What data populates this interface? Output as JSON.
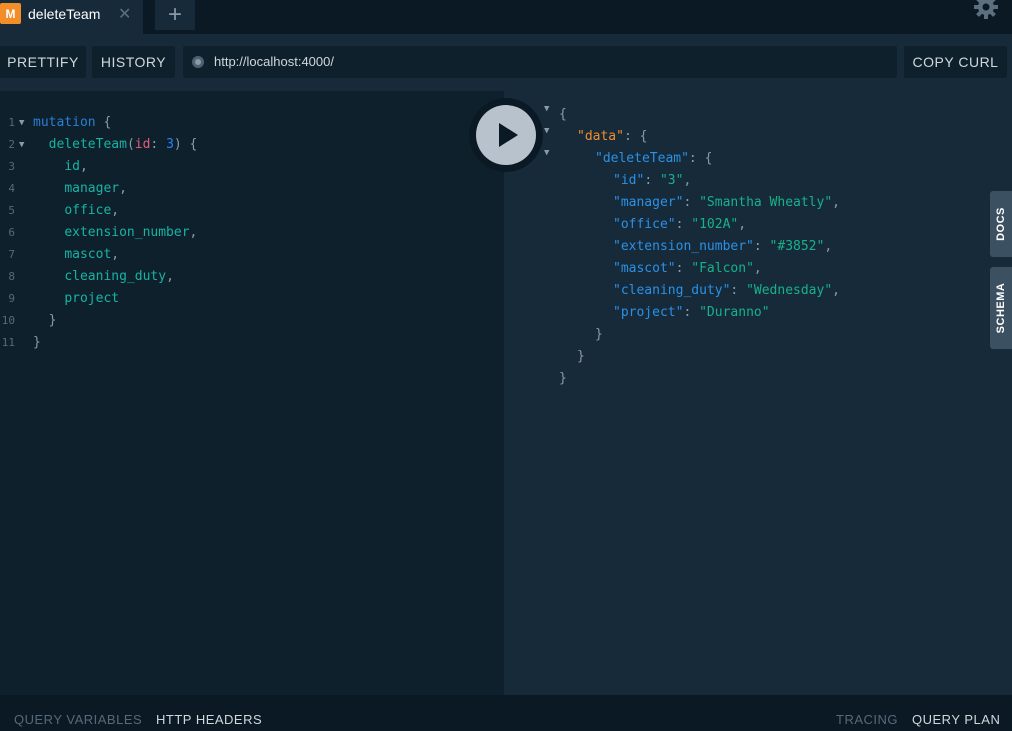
{
  "tab": {
    "badge": "M",
    "title": "deleteTeam",
    "close": "✕",
    "new_tab": "+"
  },
  "toolbar": {
    "prettify": "PRETTIFY",
    "history": "HISTORY",
    "url": "http://localhost:4000/",
    "copy_curl": "COPY CURL"
  },
  "query": {
    "lines": [
      {
        "num": "1"
      },
      {
        "num": "2"
      },
      {
        "num": "3"
      },
      {
        "num": "4"
      },
      {
        "num": "5"
      },
      {
        "num": "6"
      },
      {
        "num": "7"
      },
      {
        "num": "8"
      },
      {
        "num": "9"
      },
      {
        "num": "10"
      },
      {
        "num": "11"
      }
    ],
    "keyword": "mutation",
    "operation": "deleteTeam",
    "arg_name": "id",
    "arg_value": "3",
    "fields": [
      "id",
      "manager",
      "office",
      "extension_number",
      "mascot",
      "cleaning_duty",
      "project"
    ]
  },
  "result": {
    "data_key": "\"data\"",
    "op_key": "\"deleteTeam\"",
    "entries": [
      {
        "key": "\"id\"",
        "value": "\"3\""
      },
      {
        "key": "\"manager\"",
        "value": "\"Smantha Wheatly\""
      },
      {
        "key": "\"office\"",
        "value": "\"102A\""
      },
      {
        "key": "\"extension_number\"",
        "value": "\"#3852\""
      },
      {
        "key": "\"mascot\"",
        "value": "\"Falcon\""
      },
      {
        "key": "\"cleaning_duty\"",
        "value": "\"Wednesday\""
      },
      {
        "key": "\"project\"",
        "value": "\"Duranno\""
      }
    ]
  },
  "side_tabs": {
    "docs": "DOCS",
    "schema": "SCHEMA"
  },
  "bottom": {
    "query_variables": "QUERY VARIABLES",
    "http_headers": "HTTP HEADERS",
    "tracing": "TRACING",
    "query_plan": "QUERY PLAN"
  },
  "colors": {
    "badge": "#f28d2a",
    "keyword": "#2a7ed3",
    "field": "#17b3a3",
    "string": "#16b28b",
    "data_key": "#f28d2a"
  },
  "icons": {
    "settings": "gear-icon",
    "run": "play-icon",
    "fold": "triangle-down-icon"
  }
}
